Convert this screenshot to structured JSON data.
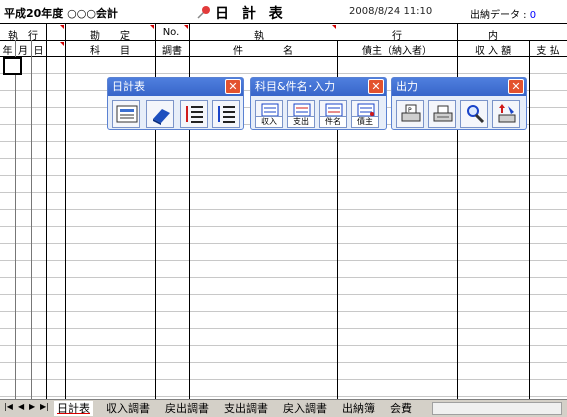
{
  "header": {
    "fiscal_year_label": "平成20年度 ○○○会計",
    "title": "日 計 表",
    "datetime": "2008/8/24 11:10",
    "cash_label": "出納データ : ",
    "cash_value": "0"
  },
  "columns_row1": {
    "exec": "執　行",
    "account": "勘　　定",
    "no": "No.",
    "exec2": "執",
    "row": "行",
    "inner": "内"
  },
  "columns_row2": {
    "year": "年",
    "month": "月",
    "day": "日",
    "subject": "科　　目",
    "survey": "調書",
    "item": "件　　　　名",
    "creditor": "債主（納入者）",
    "receipt": "収 入 額",
    "payment": "支 払"
  },
  "toolbars": [
    {
      "title": "日計表",
      "buttons": [
        {
          "name": "daily-sheet-icon",
          "label": ""
        },
        {
          "name": "fill-color-icon",
          "label": ""
        },
        {
          "name": "list-red-icon",
          "label": ""
        },
        {
          "name": "list-blue-icon",
          "label": ""
        }
      ]
    },
    {
      "title": "科目&件名･入力",
      "buttons": [
        {
          "name": "receipt-icon",
          "label": "収入"
        },
        {
          "name": "payment-icon",
          "label": "支出"
        },
        {
          "name": "item-name-icon",
          "label": "件名"
        },
        {
          "name": "creditor-icon",
          "label": "債主"
        }
      ]
    },
    {
      "title": "出力",
      "buttons": [
        {
          "name": "print-preview-icon",
          "label": ""
        },
        {
          "name": "print-icon",
          "label": ""
        },
        {
          "name": "search-icon",
          "label": ""
        },
        {
          "name": "export-icon",
          "label": ""
        }
      ]
    }
  ],
  "tabs": [
    {
      "label": "日計表",
      "active": true
    },
    {
      "label": "収入調書",
      "active": false
    },
    {
      "label": "戻出調書",
      "active": false
    },
    {
      "label": "支出調書",
      "active": false
    },
    {
      "label": "戻入調書",
      "active": false
    },
    {
      "label": "出納簿",
      "active": false
    },
    {
      "label": "会費",
      "active": false
    }
  ],
  "close_glyph": "✕"
}
